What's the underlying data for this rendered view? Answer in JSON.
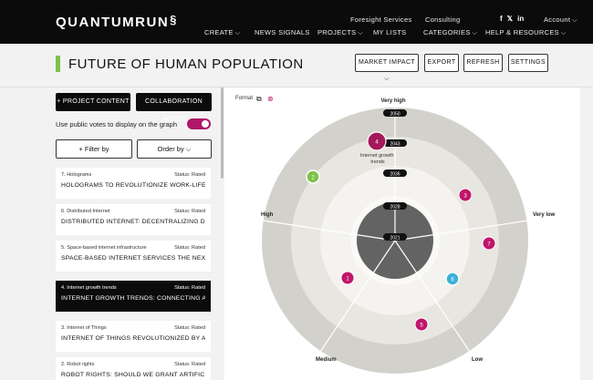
{
  "header": {
    "logo": "QUANTUMRUN",
    "logo_mark": "§",
    "nav_left": [
      "CREATE",
      "NEWS SIGNALS",
      "PROJECTS"
    ],
    "nav_top": [
      "Foresight Services",
      "Consulting",
      "Account"
    ],
    "nav_bottom": [
      "MY LISTS",
      "CATEGORIES",
      "HELP & RESOURCES"
    ],
    "social": [
      "f",
      "𝕏",
      "in"
    ]
  },
  "title": {
    "text": "FUTURE OF HUMAN POPULATION",
    "buttons": [
      "MARKET IMPACT",
      "EXPORT",
      "REFRESH",
      "SETTINGS"
    ]
  },
  "left": {
    "project_content": "+ PROJECT CONTENT",
    "collab_notes": "COLLABORATION NOTES",
    "toggle_label": "Use public votes to display on the graph",
    "filter_by": "+ Filter by",
    "order_by": "Order by",
    "cards": [
      {
        "num": "7. Holograms",
        "status": "Status: Rated",
        "desc": "HOLOGRAMS TO REVOLUTIONIZE WORK-LIFE..."
      },
      {
        "num": "6. Distributed Internet",
        "status": "Status: Rated",
        "desc": "DISTRIBUTED INTERNET: DECENTRALIZING DATA..."
      },
      {
        "num": "5. Space-based internet infrastructure",
        "status": "Status: Rated",
        "desc": "SPACE-BASED INTERNET SERVICES THE NEXT..."
      },
      {
        "num": "4. Internet growth trends",
        "status": "Status: Rated",
        "desc": "INTERNET GROWTH TRENDS: CONNECTING AN..."
      },
      {
        "num": "3. Internet of Things",
        "status": "Status: Rated",
        "desc": "INTERNET OF THINGS REVOLUTIONIZED BY AI: THE..."
      },
      {
        "num": "2. Robot rights",
        "status": "Status: Rated",
        "desc": "ROBOT RIGHTS: SHOULD WE GRANT ARTIFICIAL..."
      }
    ]
  },
  "graph": {
    "format_label": "Format",
    "labels": {
      "very_high": "Very high",
      "high": "High",
      "very_low": "Very low",
      "medium": "Medium",
      "low": "Low"
    },
    "years": [
      "2050",
      "2043",
      "2036",
      "2028",
      "2021"
    ],
    "tooltip": "Internet growth\ntrends",
    "points": [
      {
        "id": "4",
        "color": "#a3195b",
        "highlight": true
      },
      {
        "id": "2",
        "color": "#7cc24a"
      },
      {
        "id": "3",
        "color": "#c0156b"
      },
      {
        "id": "7",
        "color": "#c0156b"
      },
      {
        "id": "1",
        "color": "#c0156b"
      },
      {
        "id": "6",
        "color": "#3ab0d8"
      },
      {
        "id": "5",
        "color": "#c0156b"
      }
    ],
    "ring_colors": [
      "#d3d1cb",
      "#e8e6e0",
      "#f4f3ef",
      "#636363"
    ]
  }
}
